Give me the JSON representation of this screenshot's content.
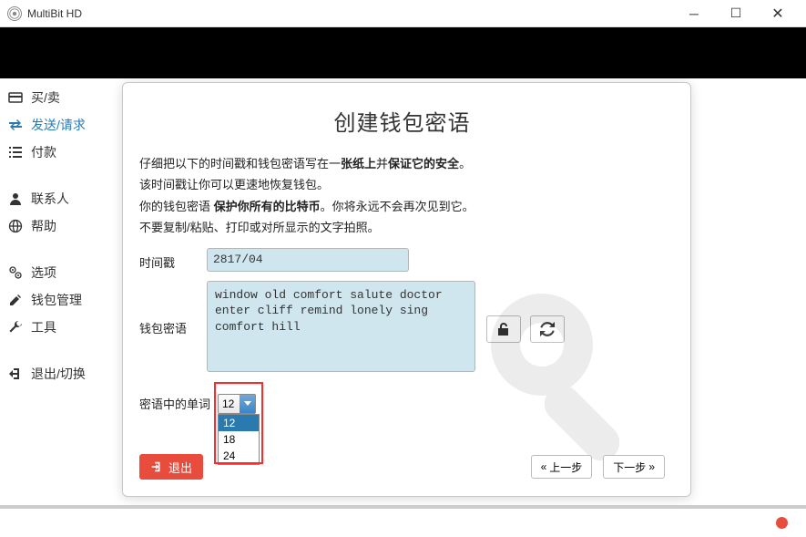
{
  "window": {
    "title": "MultiBit HD"
  },
  "sidebar": {
    "items": [
      {
        "label": "买/卖",
        "icon": "card"
      },
      {
        "label": "发送/请求",
        "icon": "transfer",
        "active": true
      },
      {
        "label": "付款",
        "icon": "list"
      },
      {
        "label": "联系人",
        "icon": "user"
      },
      {
        "label": "帮助",
        "icon": "globe"
      },
      {
        "label": "选项",
        "icon": "gears"
      },
      {
        "label": "钱包管理",
        "icon": "edit"
      },
      {
        "label": "工具",
        "icon": "wrench"
      },
      {
        "label": "退出/切换",
        "icon": "signout"
      }
    ]
  },
  "dialog": {
    "title": "创建钱包密语",
    "instructions": {
      "l1a": "仔细把以下的时间戳和钱包密语写在一",
      "l1b": "张纸上",
      "l1c": "并",
      "l1d": "保证它的安全",
      "l1e": "。",
      "l2": "该时间戳让你可以更速地恢复钱包。",
      "l3a": "你的钱包密语 ",
      "l3b": "保护你所有的比特币",
      "l3c": "。你将永远不会再次见到它。",
      "l4": "不要复制/粘贴、打印或对所显示的文字拍照。"
    },
    "timestamp_label": "时间戳",
    "timestamp_value": "2817/04",
    "seed_label": "钱包密语",
    "seed_value": "window old comfort salute doctor enter cliff remind lonely sing comfort hill",
    "wordcount_label": "密语中的单词",
    "wordcount_selected": "12",
    "wordcount_options": [
      "12",
      "18",
      "24"
    ],
    "buttons": {
      "exit": "退出",
      "prev": "上一步",
      "next": "下一步"
    }
  }
}
